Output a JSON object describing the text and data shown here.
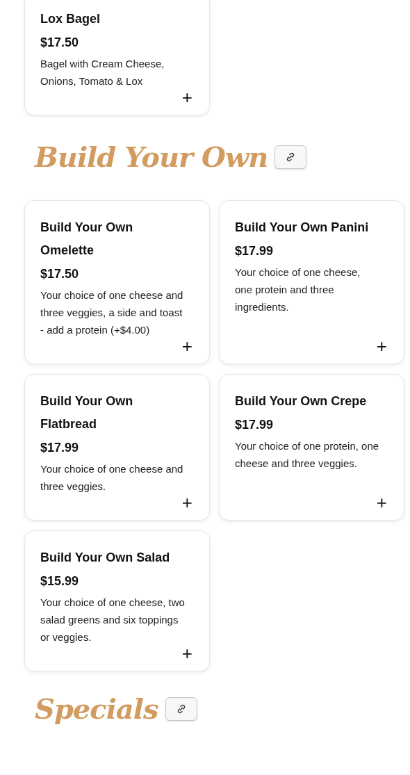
{
  "sections": [
    {
      "items": [
        {
          "name": "Lox Bagel",
          "price": "$17.50",
          "description": "Bagel with Cream Cheese, Onions, Tomato & Lox",
          "add": "+"
        }
      ]
    },
    {
      "heading": "Build Your Own",
      "items": [
        {
          "name": "Build Your Own Omelette",
          "price": "$17.50",
          "description": "Your choice of one cheese and three veggies, a side and toast - add a protein (+$4.00)",
          "add": "+"
        },
        {
          "name": "Build Your Own Panini",
          "price": "$17.99",
          "description": "Your choice of one cheese, one protein and three ingredients.",
          "add": "+"
        },
        {
          "name": "Build Your Own Flatbread",
          "price": "$17.99",
          "description": "Your choice of one cheese and three veggies.",
          "add": "+"
        },
        {
          "name": "Build Your Own Crepe",
          "price": "$17.99",
          "description": "Your choice of one protein, one cheese and three veggies.",
          "add": "+"
        },
        {
          "name": "Build Your Own Salad",
          "price": "$15.99",
          "description": "Your choice of one cheese, two salad greens and six toppings or veggies.",
          "add": "+"
        }
      ]
    },
    {
      "heading": "Specials"
    }
  ]
}
